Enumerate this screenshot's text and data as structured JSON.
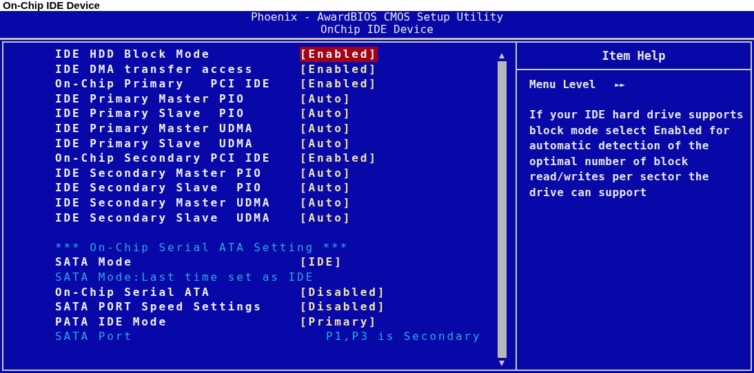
{
  "page_title": "On-Chip IDE Device",
  "header": {
    "title": "Phoenix - AwardBIOS CMOS Setup Utility",
    "subtitle": "OnChip IDE Device"
  },
  "settings": [
    {
      "kind": "setting",
      "label": "IDE HDD Block Mode",
      "value": "[Enabled]",
      "selected": true
    },
    {
      "kind": "setting",
      "label": "IDE DMA transfer access",
      "value": "[Enabled]",
      "selected": false
    },
    {
      "kind": "setting",
      "label": "On-Chip Primary   PCI IDE",
      "value": "[Enabled]",
      "selected": false
    },
    {
      "kind": "setting",
      "label": "IDE Primary Master PIO",
      "value": "[Auto]",
      "selected": false
    },
    {
      "kind": "setting",
      "label": "IDE Primary Slave  PIO",
      "value": "[Auto]",
      "selected": false
    },
    {
      "kind": "setting",
      "label": "IDE Primary Master UDMA",
      "value": "[Auto]",
      "selected": false
    },
    {
      "kind": "setting",
      "label": "IDE Primary Slave  UDMA",
      "value": "[Auto]",
      "selected": false
    },
    {
      "kind": "setting",
      "label": "On-Chip Secondary PCI IDE",
      "value": "[Enabled]",
      "selected": false
    },
    {
      "kind": "setting",
      "label": "IDE Secondary Master PIO",
      "value": "[Auto]",
      "selected": false
    },
    {
      "kind": "setting",
      "label": "IDE Secondary Slave  PIO",
      "value": "[Auto]",
      "selected": false
    },
    {
      "kind": "setting",
      "label": "IDE Secondary Master UDMA",
      "value": "[Auto]",
      "selected": false
    },
    {
      "kind": "setting",
      "label": "IDE Secondary Slave  UDMA",
      "value": "[Auto]",
      "selected": false
    },
    {
      "kind": "spacer"
    },
    {
      "kind": "heading",
      "label": "*** On-Chip Serial ATA Setting ***"
    },
    {
      "kind": "setting",
      "label": "SATA Mode",
      "value": "[IDE]",
      "selected": false
    },
    {
      "kind": "note",
      "label": "SATA Mode:Last time set as IDE"
    },
    {
      "kind": "setting",
      "label": "On-Chip Serial ATA",
      "value": "[Disabled]",
      "selected": false
    },
    {
      "kind": "setting",
      "label": "SATA PORT Speed Settings",
      "value": "[Disabled]",
      "selected": false
    },
    {
      "kind": "setting",
      "label": "PATA IDE Mode",
      "value": "[Primary]",
      "selected": false
    },
    {
      "kind": "info",
      "label": "SATA Port",
      "value": "P1,P3 is Secondary"
    }
  ],
  "help": {
    "title": "Item Help",
    "menu_level_label": "Menu Level",
    "menu_level_arrows": "►►",
    "text": "If your IDE hard drive supports block mode select Enabled for automatic detection of the optimal number of block read/writes per sector the drive can support"
  }
}
